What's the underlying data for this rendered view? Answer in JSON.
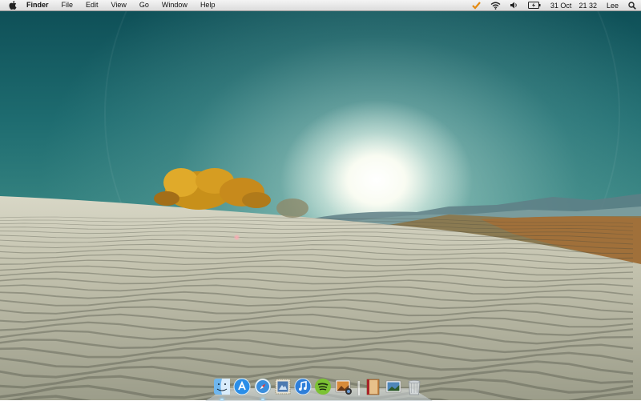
{
  "menubar": {
    "apple_icon": "apple-logo-icon",
    "app_name": "Finder",
    "menus": [
      "File",
      "Edit",
      "View",
      "Go",
      "Window",
      "Help"
    ],
    "status_icons": [
      "checkmark-icon",
      "wifi-icon",
      "volume-icon",
      "battery-icon"
    ],
    "date": "31 Oct",
    "time": "21 32",
    "user": "Lee",
    "search_icon": "spotlight-search-icon"
  },
  "dock": {
    "apps": [
      {
        "icon": "finder-icon",
        "running": true
      },
      {
        "icon": "app-store-icon",
        "running": false
      },
      {
        "icon": "safari-icon",
        "running": true
      },
      {
        "icon": "mail-stamp-icon",
        "running": false
      },
      {
        "icon": "itunes-icon",
        "running": false
      },
      {
        "icon": "spotify-icon",
        "running": false
      },
      {
        "icon": "iphoto-icon",
        "running": false
      }
    ],
    "others": [
      {
        "icon": "notebook-icon"
      },
      {
        "icon": "preview-icon"
      },
      {
        "icon": "trash-icon"
      }
    ]
  },
  "colors": {
    "sky_top": "#0d4d55",
    "sky_horizon": "#6aa9a1",
    "sand": "#c8c6b2",
    "bush": "#d49a1e"
  }
}
